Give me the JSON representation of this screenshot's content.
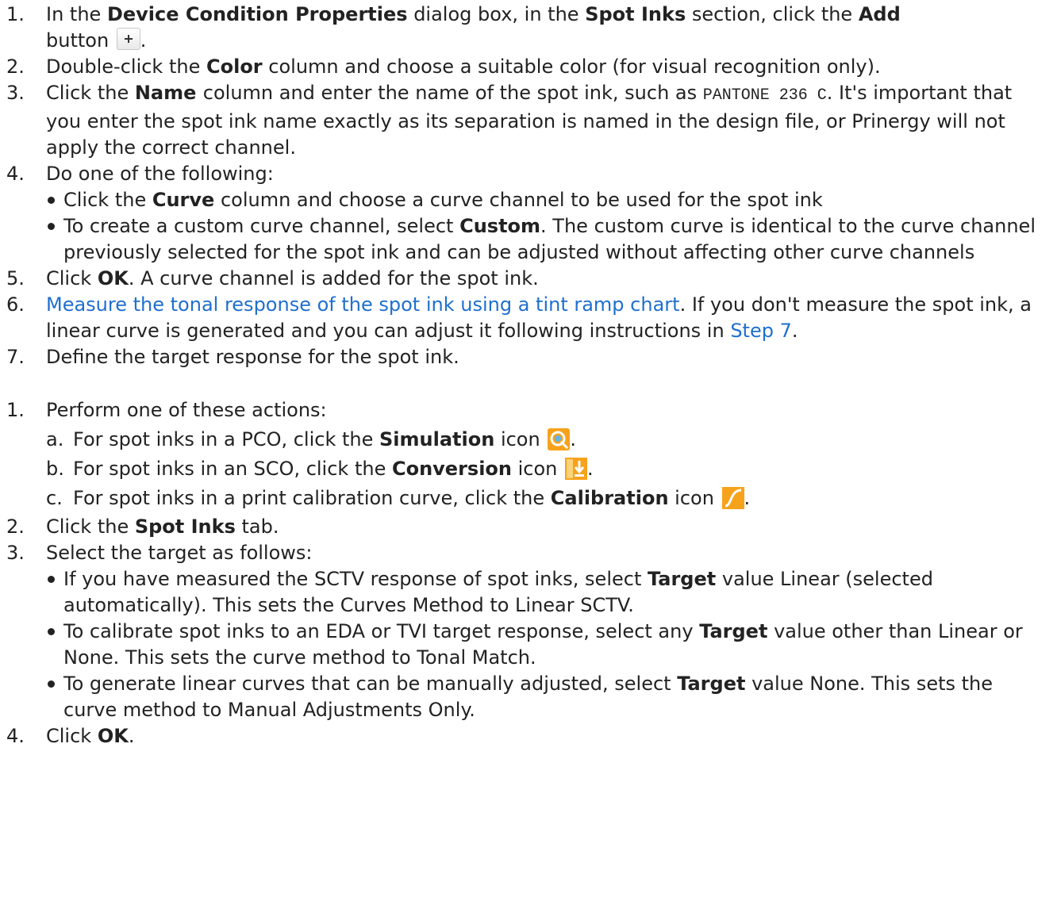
{
  "colors": {
    "text": "#222222",
    "link": "#1f6fcf",
    "icon_orange": "#f7a21b",
    "icon_blue": "#63b4e6"
  },
  "icons": {
    "add": "plus-button-icon",
    "simulation": "simulation-icon",
    "conversion": "conversion-icon",
    "calibration": "calibration-icon"
  },
  "list1": {
    "s1": {
      "num": "1.",
      "t1": "In the ",
      "b1": "Device Condition Properties",
      "t2": " dialog box, in the ",
      "b2": "Spot Inks",
      "t3": " section, click the ",
      "b3": "Add",
      "t4": " button ",
      "t5": "."
    },
    "s2": {
      "num": "2.",
      "t1": "Double-click the ",
      "b1": "Color",
      "t2": " column and choose a suitable color (for visual recognition only)."
    },
    "s3": {
      "num": "3.",
      "t1": "Click the ",
      "b1": "Name ",
      "t2": " column and enter the name of the spot ink, such as ",
      "code": "PANTONE 236 C",
      "t3": ". It's important that you enter the spot ink name exactly as its separation is named in the design file, or Prinergy will not apply the correct channel."
    },
    "s4": {
      "num": "4.",
      "t1": "Do one of the following:",
      "bullet1": {
        "t1": "Click the ",
        "b1": "Curve",
        "t2": " column and choose a curve channel to be used for the spot ink"
      },
      "bullet2": {
        "t1": "To create a custom curve channel, select ",
        "b1": "Custom",
        "t2": ". The custom curve is identical to the curve channel previously selected for the spot ink and can be adjusted without affecting other curve channels"
      }
    },
    "s5": {
      "num": "5.",
      "t1": "Click ",
      "b1": "OK",
      "t2": ". A curve channel is added for the spot ink."
    },
    "s6": {
      "num": "6.",
      "link1": "Measure the tonal response of the spot ink using a tint ramp chart",
      "t1": ". If you don't measure the spot ink, a linear curve is generated and you can adjust it following instructions in ",
      "link2": "Step 7",
      "t2": "."
    },
    "s7": {
      "num": "7.",
      "t1": "Define the target response for the spot ink."
    }
  },
  "list2": {
    "s1": {
      "num": "1.",
      "t1": "Perform one of these actions:",
      "a": {
        "letter": "a.",
        "t1": "For spot inks in a PCO, click the ",
        "b1": "Simulation",
        "t2": " icon ",
        "t3": "."
      },
      "b": {
        "letter": "b.",
        "t1": "For spot inks in an SCO, click the ",
        "b1": "Conversion",
        "t2": " icon ",
        "t3": "."
      },
      "c": {
        "letter": "c.",
        "t1": "For spot inks in a print calibration curve, click the ",
        "b1": "Calibration",
        "t2": " icon ",
        "t3": "."
      }
    },
    "s2": {
      "num": "2.",
      "t1": "Click the ",
      "b1": "Spot Inks",
      "t2": " tab."
    },
    "s3": {
      "num": "3.",
      "t1": "Select the target as follows:",
      "bullet1": {
        "t1": "If you have measured the SCTV response of spot inks, select ",
        "b1": "Target",
        "t2": " value Linear (selected automatically). This sets the Curves Method to Linear SCTV."
      },
      "bullet2": {
        "t1": "To calibrate spot inks to an EDA or TVI target response, select any ",
        "b1": "Target",
        "t2": " value other than Linear or None. This sets the curve method to Tonal Match."
      },
      "bullet3": {
        "t1": "To generate linear curves that can be manually adjusted, select ",
        "b1": "Target",
        "t2": " value None. This sets the curve method to Manual Adjustments Only."
      }
    },
    "s4": {
      "num": "4.",
      "t1": "Click ",
      "b1": "OK",
      "t2": "."
    }
  }
}
